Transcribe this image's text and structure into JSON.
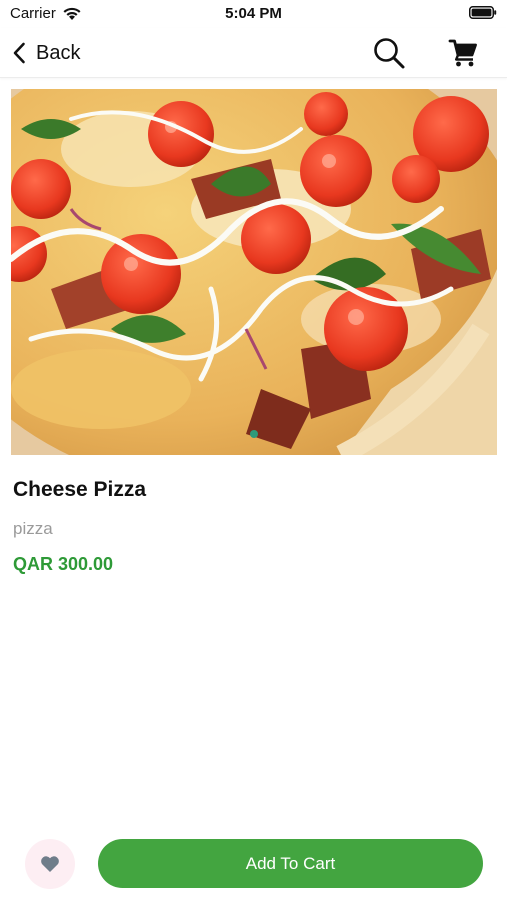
{
  "status_bar": {
    "carrier": "Carrier",
    "time": "5:04 PM",
    "icons": [
      "wifi-icon",
      "battery-icon"
    ]
  },
  "nav": {
    "back_label": "Back",
    "icons": [
      "chevron-left-icon",
      "search-icon",
      "cart-icon"
    ]
  },
  "product": {
    "image": "cheese-pizza-photo",
    "name": "Cheese Pizza",
    "category": "pizza",
    "price": "QAR 300.00"
  },
  "actions": {
    "favorite_icon": "heart-icon",
    "add_to_cart_label": "Add To Cart"
  },
  "colors": {
    "accent_green": "#43a540",
    "price_green": "#2e9a37",
    "favorite_bg": "#fdeef3",
    "heart_gray": "#6f7d8a"
  }
}
